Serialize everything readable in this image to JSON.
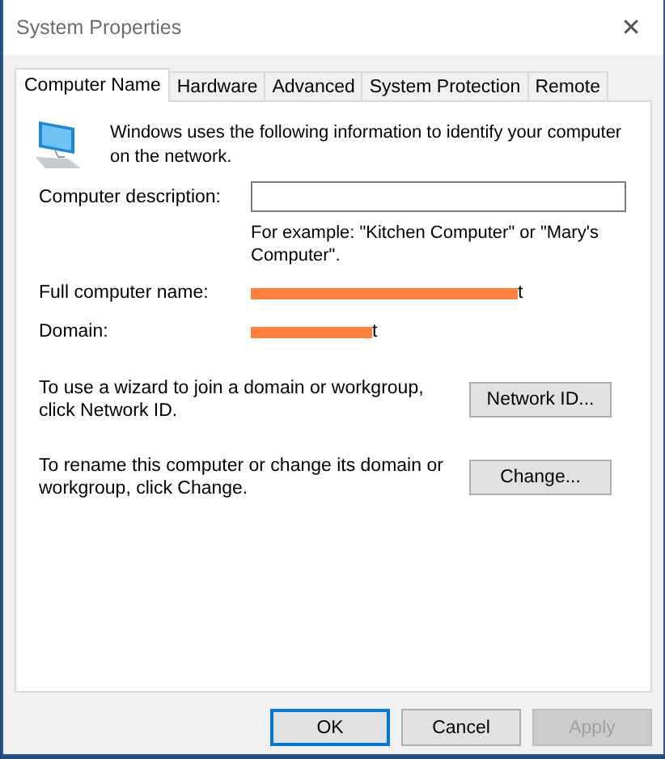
{
  "window": {
    "title": "System Properties",
    "close": "✕"
  },
  "tabs": [
    {
      "label": "Computer Name",
      "selected": true
    },
    {
      "label": "Hardware",
      "selected": false
    },
    {
      "label": "Advanced",
      "selected": false
    },
    {
      "label": "System Protection",
      "selected": false
    },
    {
      "label": "Remote",
      "selected": false
    }
  ],
  "intro": "Windows uses the following information to identify your computer on the network.",
  "description": {
    "label": "Computer description:",
    "hint": "For example: \"Kitchen Computer\" or \"Mary's Computer\"."
  },
  "info": [
    {
      "label": "Full computer name:",
      "redacted": true,
      "visible_tail": "t"
    },
    {
      "label": "Domain:",
      "redacted": true,
      "visible_tail": "t"
    }
  ],
  "actions": [
    {
      "text": "To use a wizard to join a domain or workgroup, click Network ID.",
      "button": "Network ID..."
    },
    {
      "text": "To rename this computer or change its domain or workgroup, click Change.",
      "button": "Change..."
    }
  ],
  "buttons": [
    {
      "label": "OK",
      "default": true,
      "disabled": false
    },
    {
      "label": "Cancel",
      "default": false,
      "disabled": false
    },
    {
      "label": "Apply",
      "default": false,
      "disabled": true
    }
  ]
}
